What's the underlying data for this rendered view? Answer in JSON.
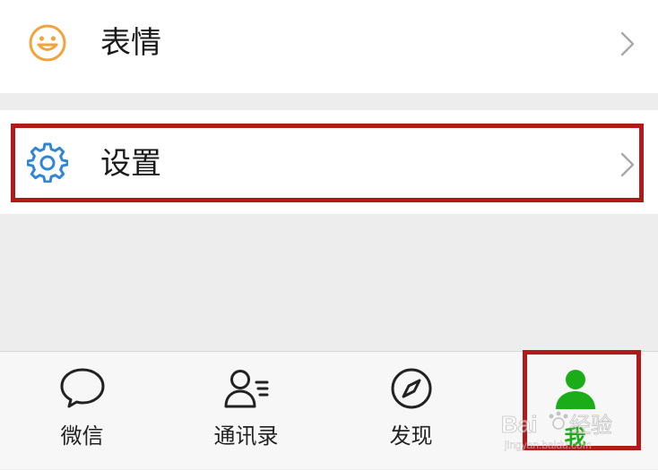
{
  "list": {
    "items": [
      {
        "label": "表情",
        "icon": "smile-icon",
        "icon_color": "#f2a33c"
      },
      {
        "label": "设置",
        "icon": "gear-icon",
        "icon_color": "#2f86d6"
      }
    ]
  },
  "tabbar": {
    "tabs": [
      {
        "label": "微信",
        "icon": "chat-bubble-icon",
        "active": false
      },
      {
        "label": "通讯录",
        "icon": "contacts-icon",
        "active": false
      },
      {
        "label": "发现",
        "icon": "compass-icon",
        "active": false
      },
      {
        "label": "我",
        "icon": "person-icon",
        "active": true
      }
    ],
    "active_color": "#1aad19"
  },
  "highlight_color": "#b11a1a"
}
